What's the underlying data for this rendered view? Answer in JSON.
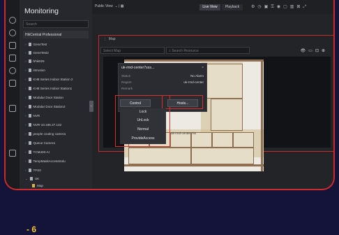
{
  "header": {
    "title": "Monitoring",
    "view_name": "Public View",
    "live_view": "Live View",
    "playback": "Playback"
  },
  "sidebar": {
    "search_placeholder": "Search",
    "root": "HikCentral Professional",
    "items": [
      "GeneTest",
      "GeneTest2",
      "bhik025",
      "intrusion",
      "KH8 Series Indoor Station 2",
      "KH8 Series Indoor Station1",
      "Modular Door Station",
      "Modular Door Station2",
      "NVR",
      "NVR-10.185.27.132",
      "people couting camera",
      "Queue Camera",
      "TCM400-AI",
      "TempMaskAccessSolu",
      "TFS0",
      "UK",
      "Map"
    ]
  },
  "panel": {
    "header": "Map",
    "select_map_placeholder": "Select Map",
    "search_placeholder": "Search Resource"
  },
  "popup": {
    "title": "uk-rmd-center7sss...",
    "status_label": "Status",
    "status_value": "No Alarm",
    "region_label": "Region",
    "region_value": "uk-rmd-center",
    "remark_label": "Remark",
    "control_button": "Control",
    "hosts_button": "Hosts..."
  },
  "dropdown": {
    "items": [
      "Lock",
      "UnLock",
      "Normal",
      "ProvideAccess"
    ]
  },
  "map_label": "uk-rmd-center 7ss",
  "footer": {
    "text": "- 6"
  }
}
